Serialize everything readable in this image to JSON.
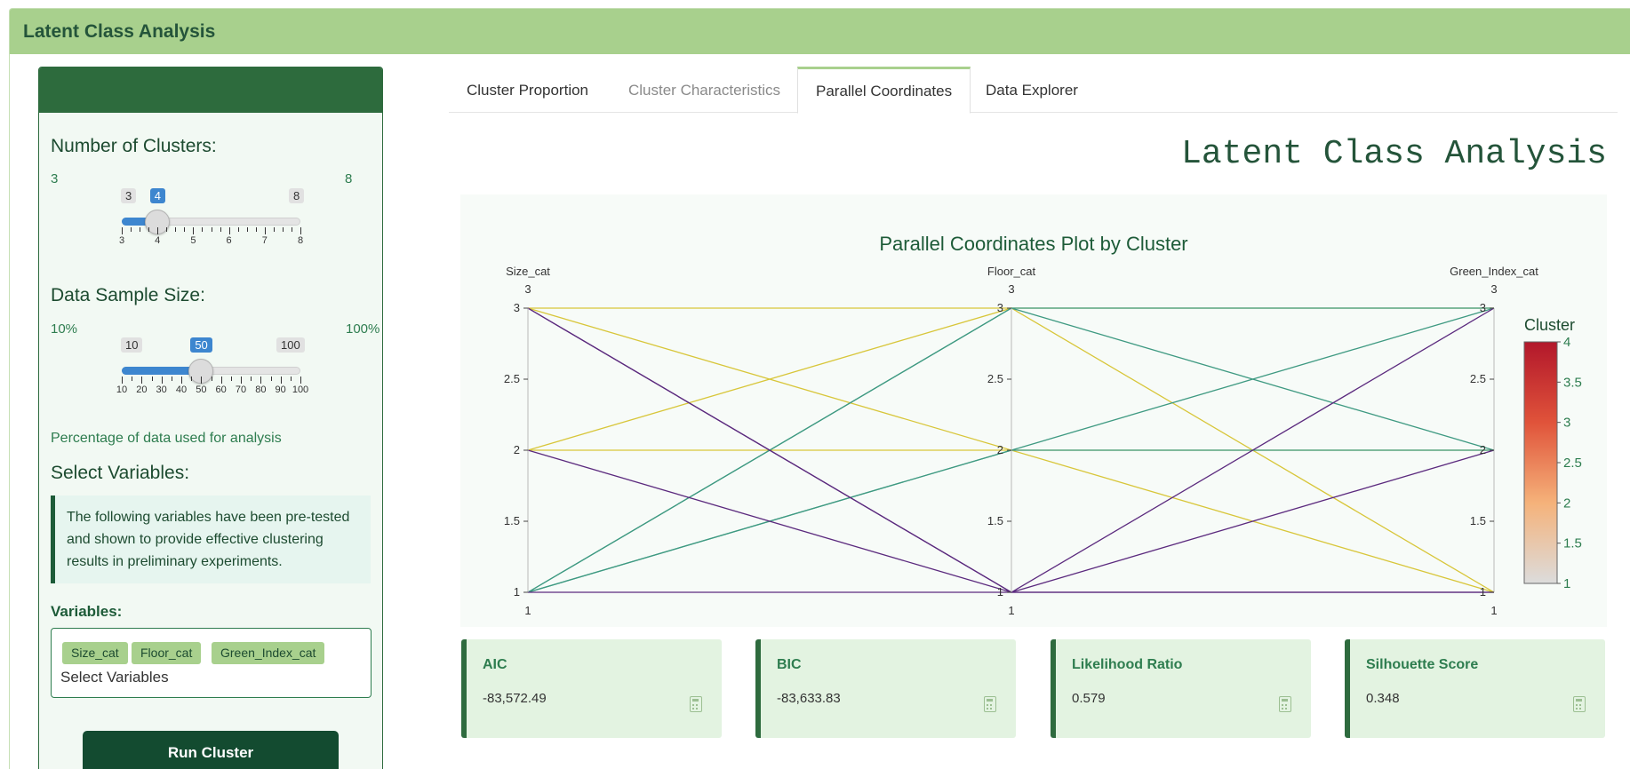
{
  "app": {
    "title": "Latent Class Analysis"
  },
  "sidebar": {
    "clusters": {
      "label": "Number of Clusters:",
      "min_label": "3",
      "max_label": "8",
      "value": 4,
      "min": 3,
      "max": 8,
      "badge_min": "3",
      "badge_max": "8",
      "badge_value": "4",
      "ticks": [
        "3",
        "4",
        "5",
        "6",
        "7",
        "8"
      ]
    },
    "sample": {
      "label": "Data Sample Size:",
      "min_label": "10%",
      "max_label": "100%",
      "value": 50,
      "min": 10,
      "max": 100,
      "badge_min": "10",
      "badge_max": "100",
      "badge_value": "50",
      "ticks": [
        "10",
        "20",
        "30",
        "40",
        "50",
        "60",
        "70",
        "80",
        "90",
        "100"
      ]
    },
    "sample_note": "Percentage of data used for analysis",
    "select_heading": "Select Variables:",
    "callout": "The following variables have been pre-tested and shown to provide effective clustering results in preliminary experiments.",
    "variables_label": "Variables:",
    "chips": [
      "Size_cat",
      "Floor_cat",
      "Green_Index_cat"
    ],
    "placeholder": "Select Variables",
    "run_button": "Run Cluster"
  },
  "tabs": [
    {
      "label": "Cluster Proportion",
      "state": "normal"
    },
    {
      "label": "Cluster Characteristics",
      "state": "dim"
    },
    {
      "label": "Parallel Coordinates",
      "state": "active"
    },
    {
      "label": "Data Explorer",
      "state": "normal"
    }
  ],
  "main": {
    "big_title": "Latent Class Analysis"
  },
  "chart_data": {
    "type": "parallel_coordinates",
    "title": "Parallel Coordinates Plot by Cluster",
    "dimensions": [
      "Size_cat",
      "Floor_cat",
      "Green_Index_cat"
    ],
    "axis_range": [
      1,
      3
    ],
    "axis_top_label": "3",
    "axis_bottom_label": "1",
    "axis_ticks": [
      "3",
      "2.5",
      "2",
      "1.5",
      "1"
    ],
    "colorbar": {
      "title": "Cluster",
      "range": [
        1,
        4
      ],
      "ticks": [
        "4",
        "3.5",
        "3",
        "2.5",
        "2",
        "1.5",
        "1"
      ],
      "colors": [
        "#dcdcdc",
        "#f5b27a",
        "#e0533a",
        "#b2172b"
      ]
    },
    "line_colors": {
      "purple": "#5b2a7e",
      "teal": "#3f9a82",
      "yellow": "#d8c63a"
    },
    "lines": [
      {
        "color": "yellow",
        "values": [
          3,
          3,
          3
        ]
      },
      {
        "color": "yellow",
        "values": [
          3,
          2,
          2
        ]
      },
      {
        "color": "yellow",
        "values": [
          2,
          3,
          1
        ]
      },
      {
        "color": "yellow",
        "values": [
          2,
          2,
          1
        ]
      },
      {
        "color": "teal",
        "values": [
          1,
          3,
          3
        ]
      },
      {
        "color": "teal",
        "values": [
          1,
          3,
          2
        ]
      },
      {
        "color": "teal",
        "values": [
          1,
          2,
          3
        ]
      },
      {
        "color": "teal",
        "values": [
          1,
          2,
          2
        ]
      },
      {
        "color": "purple",
        "values": [
          3,
          1,
          3
        ]
      },
      {
        "color": "purple",
        "values": [
          3,
          1,
          2
        ]
      },
      {
        "color": "purple",
        "values": [
          2,
          1,
          1
        ]
      },
      {
        "color": "purple",
        "values": [
          1,
          1,
          1
        ]
      }
    ]
  },
  "metrics": [
    {
      "title": "AIC",
      "value": "-83,572.49",
      "icon": "calculator-icon"
    },
    {
      "title": "BIC",
      "value": "-83,633.83",
      "icon": "calculator-icon"
    },
    {
      "title": "Likelihood Ratio",
      "value": "0.579",
      "icon": "calculator-icon"
    },
    {
      "title": "Silhouette Score",
      "value": "0.348",
      "icon": "calculator-icon"
    }
  ]
}
